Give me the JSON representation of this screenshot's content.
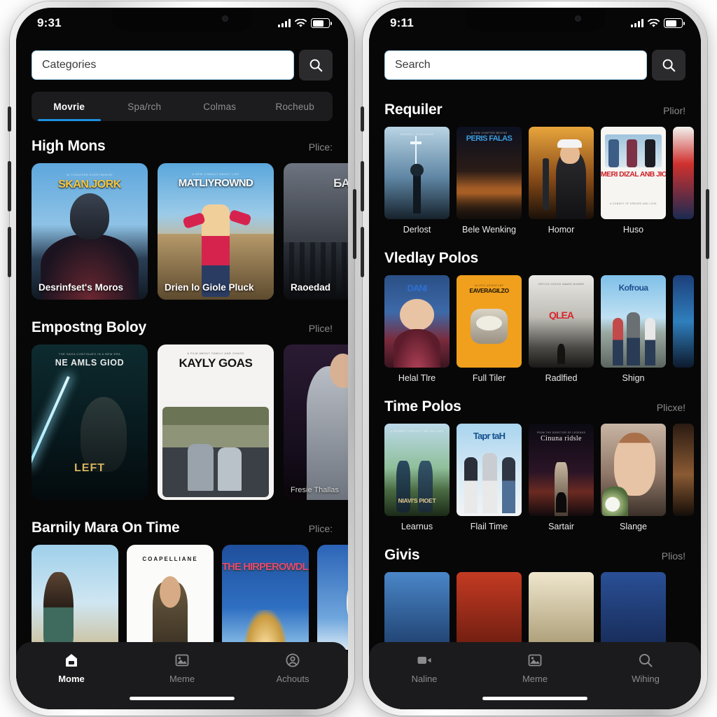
{
  "accent": "#1d8fe0",
  "background": "#070707",
  "phones": [
    {
      "id": "left",
      "status": {
        "time": "9:31",
        "signal_icon": "signal-bars-icon",
        "wifi_icon": "wifi-icon",
        "battery_icon": "battery-icon"
      },
      "search": {
        "value": "Categories",
        "placeholder": "Categories",
        "button_icon": "search-icon"
      },
      "tabs": [
        {
          "label": "Movrie",
          "active": true
        },
        {
          "label": "Spa/rch",
          "active": false
        },
        {
          "label": "Colmas",
          "active": false
        },
        {
          "label": "Rocheub",
          "active": false
        }
      ],
      "sections": [
        {
          "title": "High Mons",
          "more": "Plice:",
          "items": [
            {
              "caption": "Desrinfset's Moros",
              "poster_title": "SKAN.JORK"
            },
            {
              "caption": "Drien lo Giole Pluck",
              "poster_title": "MATLIYROWND"
            },
            {
              "caption": "Raoedad",
              "poster_title": "БА"
            }
          ]
        },
        {
          "title": "Empostng Boloy",
          "more": "Plice!",
          "items": [
            {
              "caption": "",
              "poster_title": "NE AMLS GIOD",
              "poster_sub": "LEFT"
            },
            {
              "caption": "",
              "poster_title": "KAYLY GOAS"
            },
            {
              "caption": "Fresie Thallas",
              "poster_title": ""
            }
          ]
        },
        {
          "title": "Barnily Mara On Time",
          "more": "Plice:",
          "items": [
            {
              "caption": "",
              "poster_title": ""
            },
            {
              "caption": "",
              "poster_title": "COAPELLIANE"
            },
            {
              "caption": "",
              "poster_title": "THE HIRPEROWDLES"
            },
            {
              "caption": "",
              "poster_title": ""
            }
          ]
        }
      ],
      "tabbar": [
        {
          "label": "Mome",
          "icon": "home-icon",
          "active": true
        },
        {
          "label": "Meme",
          "icon": "image-icon",
          "active": false
        },
        {
          "label": "Achouts",
          "icon": "account-icon",
          "active": false
        }
      ]
    },
    {
      "id": "right",
      "status": {
        "time": "9:11",
        "signal_icon": "signal-bars-icon",
        "wifi_icon": "wifi-icon",
        "battery_icon": "battery-icon"
      },
      "search": {
        "value": "Search",
        "placeholder": "Search",
        "button_icon": "search-icon"
      },
      "sections": [
        {
          "title": "Requiler",
          "more": "Plior!",
          "items": [
            {
              "label": "Derlost",
              "poster_title": ""
            },
            {
              "label": "Bele Wenking",
              "poster_title": "PERIS FALAS"
            },
            {
              "label": "Homor",
              "poster_title": ""
            },
            {
              "label": "Huso",
              "poster_title": "MERI DIZAL ANB JIONE"
            },
            {
              "label": "",
              "poster_title": ""
            }
          ]
        },
        {
          "title": "Vledlay Polos",
          "more": "",
          "items": [
            {
              "label": "Helal Tlre",
              "poster_title": "DANI"
            },
            {
              "label": "Full Tiler",
              "poster_title": "EAVERAGILZO"
            },
            {
              "label": "Radlfied",
              "poster_title": "QLEA"
            },
            {
              "label": "Shign",
              "poster_title": "Kofroua"
            },
            {
              "label": "",
              "poster_title": ""
            }
          ]
        },
        {
          "title": "Time Polos",
          "more": "Plicxe!",
          "items": [
            {
              "label": "Learnus",
              "poster_title": "NIAVI'S PIOET"
            },
            {
              "label": "Flail Time",
              "poster_title": "Tapr taH"
            },
            {
              "label": "Sartair",
              "poster_title": "Cinuna ridsle"
            },
            {
              "label": "Slange",
              "poster_title": ""
            },
            {
              "label": "",
              "poster_title": ""
            }
          ]
        },
        {
          "title": "Givis",
          "more": "Plios!",
          "items": [
            {
              "label": "",
              "poster_title": ""
            },
            {
              "label": "",
              "poster_title": ""
            },
            {
              "label": "",
              "poster_title": ""
            },
            {
              "label": "",
              "poster_title": ""
            }
          ]
        }
      ],
      "tabbar": [
        {
          "label": "Naline",
          "icon": "video-icon",
          "active": false
        },
        {
          "label": "Meme",
          "icon": "image-icon",
          "active": false
        },
        {
          "label": "Wihing",
          "icon": "search-icon",
          "active": false
        }
      ]
    }
  ]
}
